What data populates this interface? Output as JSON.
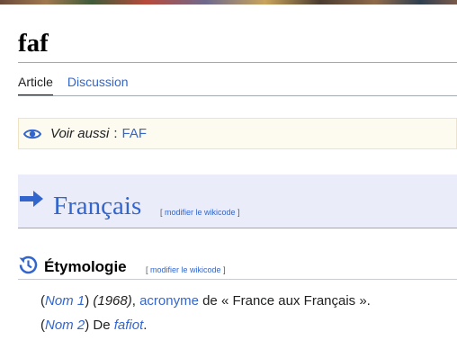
{
  "page": {
    "title": "faf"
  },
  "tabs": [
    {
      "label": "Article",
      "active": true
    },
    {
      "label": "Discussion",
      "active": false
    }
  ],
  "notice": {
    "label": "Voir aussi",
    "separator": ":",
    "link": "FAF"
  },
  "language": {
    "name": "Français",
    "edit_open": "[",
    "edit_label": "modifier le wikicode",
    "edit_close": "]"
  },
  "section": {
    "name": "Étymologie",
    "edit_open": "[",
    "edit_label": "modifier le wikicode",
    "edit_close": "]"
  },
  "definitions": [
    {
      "open": "(",
      "tag": "Nom 1",
      "close": ")",
      "date": "(1968)",
      "comma": ",",
      "link": "acronyme",
      "rest": "de « France aux Français »."
    },
    {
      "open": "(",
      "tag": "Nom 2",
      "close": ")",
      "text": "De",
      "link": "fafiot",
      "end": "."
    }
  ],
  "colors": {
    "link": "#3366cc",
    "lang_band": "#eaecf9",
    "notice_bg": "#fdfbef"
  },
  "icons": {
    "notice": "eye-icon",
    "language": "arrow-right-icon",
    "section": "history-clock-icon"
  }
}
